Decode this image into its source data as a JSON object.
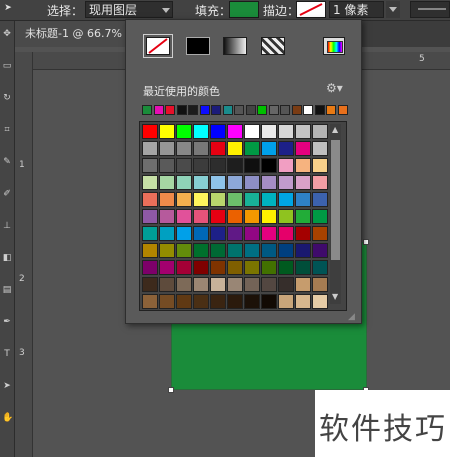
{
  "options_bar": {
    "select_label": "选择：",
    "select_value": "现用图层",
    "fill_label": "填充：",
    "fill_color": "#1a8c3a",
    "stroke_label": "描边：",
    "stroke_width": "1 像素"
  },
  "document_tab": {
    "title": "未标题-1 @ 66.7%"
  },
  "ruler": {
    "top_label": "5",
    "left_labels": [
      "1",
      "2",
      "3"
    ]
  },
  "color_picker": {
    "fill_types": [
      "no-color",
      "solid-color",
      "gradient",
      "pattern"
    ],
    "selected_fill_type": "no-color",
    "recent_label": "最近使用的颜色",
    "recent_colors": [
      "#1a8c3a",
      "#e60eb5",
      "#e8102a",
      "#111111",
      "#1c1c1c",
      "#0c0cff",
      "#1c1c7a",
      "#1a8c8c",
      "#555555",
      "#444444",
      "#00c000",
      "#666666",
      "#555555",
      "#7a3c14",
      "#ffffff",
      "#111111",
      "#e87a14",
      "#e8701c"
    ],
    "swatch_rows": [
      [
        "#ff0000",
        "#ffff00",
        "#00ff00",
        "#00ffff",
        "#0000ff",
        "#ff00ff",
        "#ffffff",
        "#ebebeb",
        "#d7d7d7",
        "#c3c3c3",
        "#b4b4b4"
      ],
      [
        "#a5a5a5",
        "#969696",
        "#878787",
        "#787878",
        "#e60012",
        "#fff100",
        "#009944",
        "#00a0e9",
        "#1d2088",
        "#e4007f",
        "#bfbfbf"
      ],
      [
        "#6e6e6e",
        "#5a5a5a",
        "#4b4b4b",
        "#3c3c3c",
        "#2d2d2d",
        "#1e1e1e",
        "#0f0f0f",
        "#000000",
        "#f19ec2",
        "#f6b37f",
        "#f8d08a"
      ],
      [
        "#c7e0a6",
        "#a6d7a3",
        "#8fd3b8",
        "#87cfd3",
        "#8fc4ea",
        "#8da8d8",
        "#8e8fc6",
        "#a58dc4",
        "#c19bcc",
        "#d9a1c8",
        "#f39ea5"
      ],
      [
        "#ea6f5a",
        "#ef8a4a",
        "#f4b04e",
        "#fff45c",
        "#b9d66c",
        "#6cbf6a",
        "#18b198",
        "#00b3bf",
        "#00a5e3",
        "#2e81c6",
        "#3c62ad"
      ],
      [
        "#8e59a5",
        "#b65a9c",
        "#e1519a",
        "#e5537a",
        "#e60012",
        "#eb6100",
        "#f39800",
        "#fff100",
        "#8fc31f",
        "#22ac38",
        "#009944"
      ],
      [
        "#009e96",
        "#00a0c1",
        "#00a0e9",
        "#0068b7",
        "#1d2088",
        "#601986",
        "#920783",
        "#e4007f",
        "#e5006a",
        "#a40000",
        "#a84200"
      ],
      [
        "#b28500",
        "#938c00",
        "#638c0b",
        "#00702c",
        "#006934",
        "#00736d",
        "#006f83",
        "#005982",
        "#003f7f",
        "#1a186f",
        "#3f0b6b"
      ],
      [
        "#7d0069",
        "#a3006e",
        "#a40036",
        "#7f0000",
        "#7e3300",
        "#7f5f00",
        "#7a7500",
        "#427100",
        "#005a1f",
        "#004e3a",
        "#005455"
      ],
      [
        "#3d2a1c",
        "#5e4b3c",
        "#7d6a58",
        "#9b8673",
        "#c7b299",
        "#998675",
        "#736357",
        "#534741",
        "#362e2b",
        "#c69c6d",
        "#a67c52"
      ],
      [
        "#8c6239",
        "#754c24",
        "#603913",
        "#4a2f14",
        "#3a2411",
        "#2b1a0c",
        "#1c1108",
        "#120a04",
        "#c8a57a",
        "#d7b78e",
        "#e6cca6"
      ]
    ]
  }
}
